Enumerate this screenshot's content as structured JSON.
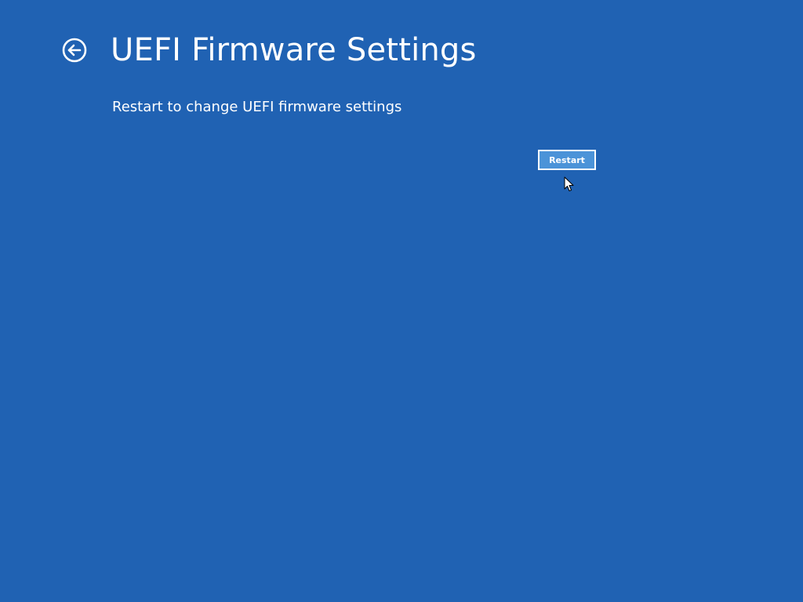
{
  "header": {
    "back_icon": "back-arrow-circle-icon",
    "title": "UEFI Firmware Settings"
  },
  "main": {
    "description": "Restart to change UEFI firmware settings",
    "restart_label": "Restart"
  },
  "colors": {
    "background": "#2062b3",
    "button_fill": "#4b93d8",
    "text": "#ffffff"
  },
  "cursor_icon": "mouse-pointer-icon"
}
